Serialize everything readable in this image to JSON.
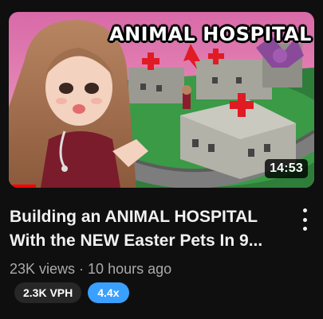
{
  "video": {
    "thumbnail_text": "ANIMAL HOSPITAL",
    "duration": "14:53",
    "watch_progress": 0.09,
    "title_line1": "Building an ANIMAL HOSPITAL",
    "title_line2": "With the NEW Easter Pets In 9...",
    "views": "23K views",
    "separator": "·",
    "age": "10 hours ago"
  },
  "badges": {
    "vph": "2.3K VPH",
    "multiplier": "4.4x"
  },
  "colors": {
    "background": "#0f0f0f",
    "vph_badge": "#272727",
    "multiplier_badge": "#3aa0ff",
    "progress": "#ff0000"
  },
  "icons": {
    "menu": "vertical-ellipsis-icon"
  }
}
